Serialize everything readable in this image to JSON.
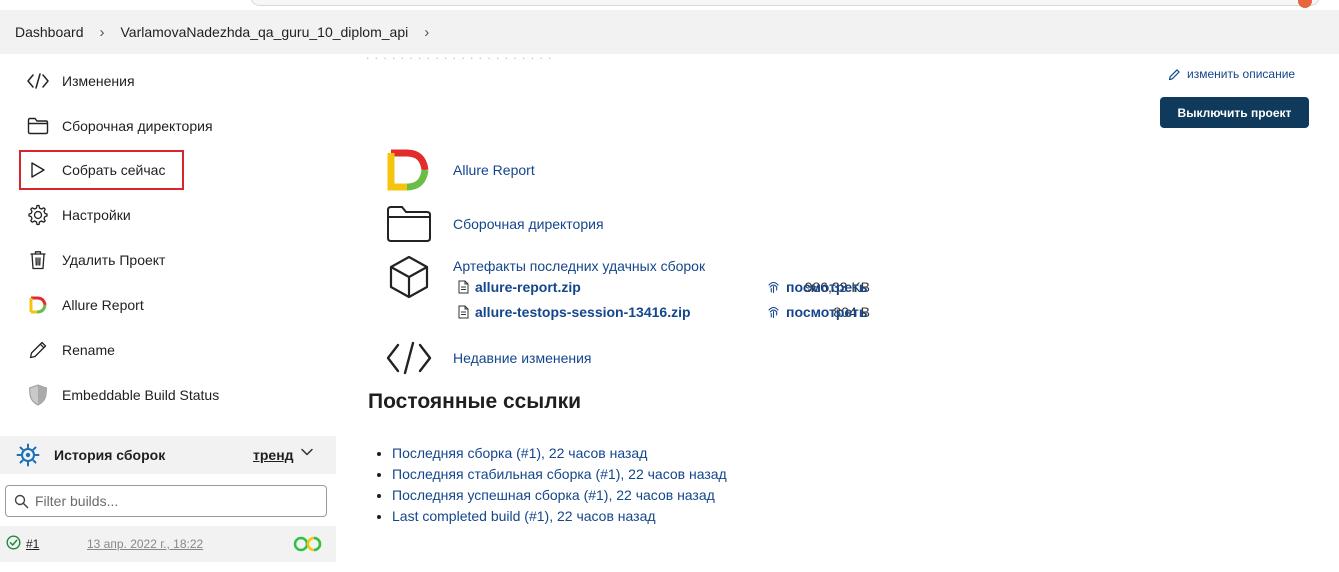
{
  "breadcrumb": [
    "Dashboard",
    "VarlamovaNadezhda_qa_guru_10_diplom_api"
  ],
  "sidebar": {
    "tasks": [
      {
        "label": "Изменения",
        "icon": "code-icon"
      },
      {
        "label": "Сборочная директория",
        "icon": "folder-icon"
      },
      {
        "label": "Собрать сейчас",
        "icon": "play-icon"
      },
      {
        "label": "Настройки",
        "icon": "gear-icon"
      },
      {
        "label": "Удалить Проект",
        "icon": "trash-icon"
      },
      {
        "label": "Allure Report",
        "icon": "allure-logo-icon"
      },
      {
        "label": "Rename",
        "icon": "pencil-icon"
      },
      {
        "label": "Embeddable Build Status",
        "icon": "shield-icon"
      }
    ],
    "history": {
      "title": "История сборок",
      "trend": "тренд",
      "filter_placeholder": "Filter builds...",
      "builds": [
        {
          "number": "#1",
          "date": "13 апр. 2022 г., 18:22"
        }
      ]
    }
  },
  "main": {
    "edit_description": "изменить описание",
    "disable_button": "Выключить проект",
    "links": {
      "allure": "Allure Report",
      "workspace": "Сборочная директория",
      "artifacts_title": "Артефакты последних удачных сборок",
      "changes": "Недавние изменения"
    },
    "artifacts": [
      {
        "name": "allure-report.zip",
        "size": "986,33 KB",
        "view": "посмотреть"
      },
      {
        "name": "allure-testops-session-13416.zip",
        "size": "804 B",
        "view": "посмотреть"
      }
    ],
    "permalinks_title": "Постоянные ссылки",
    "permalinks": [
      "Последняя сборка (#1), 22 часов назад",
      "Последняя стабильная сборка (#1), 22 часов назад",
      "Последняя успешная сборка (#1), 22 часов назад",
      "Last completed build (#1), 22 часов назад"
    ]
  },
  "colors": {
    "link": "#14468c",
    "button_bg": "#0f3a5c",
    "highlight": "#d9232d",
    "panel_bg": "#f2f2f2"
  }
}
